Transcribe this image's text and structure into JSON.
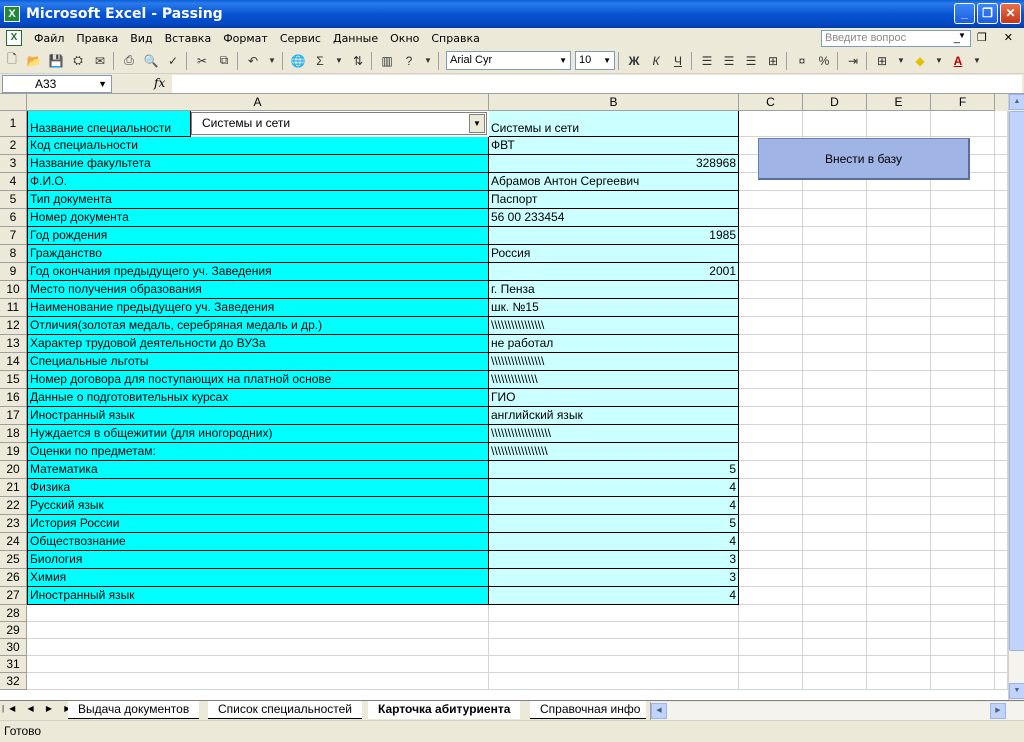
{
  "window": {
    "title": "Microsoft Excel - Passing",
    "app_icon": "X"
  },
  "menu": {
    "items": [
      "Файл",
      "Правка",
      "Вид",
      "Вставка",
      "Формат",
      "Сервис",
      "Данные",
      "Окно",
      "Справка"
    ],
    "help_placeholder": "Введите вопрос"
  },
  "toolbar": {
    "font_name": "Arial Cyr",
    "font_size": "10",
    "bold": "Ж",
    "italic": "К",
    "underline": "Ч",
    "percent": "%",
    "sum": "Σ"
  },
  "formula_bar": {
    "cell_ref": "A33",
    "fx": "fx",
    "content": ""
  },
  "columns": [
    "A",
    "B",
    "C",
    "D",
    "E",
    "F"
  ],
  "combo": {
    "value": "Системы и сети"
  },
  "macro_button": {
    "label": "Внести в базу"
  },
  "rows": [
    {
      "n": "1",
      "a": "Название специальности",
      "b": "Системы и сети",
      "num": false
    },
    {
      "n": "2",
      "a": "Код специальности",
      "b": "ФВТ",
      "num": false
    },
    {
      "n": "3",
      "a": "Название факультета",
      "b": "328968",
      "num": true
    },
    {
      "n": "4",
      "a": "Ф.И.О.",
      "b": "Абрамов Антон Сергеевич",
      "num": false
    },
    {
      "n": "5",
      "a": "Тип документа",
      "b": "Паспорт",
      "num": false
    },
    {
      "n": "6",
      "a": "Номер документа",
      "b": "56 00 233454",
      "num": false
    },
    {
      "n": "7",
      "a": "Год рождения",
      "b": "1985",
      "num": true
    },
    {
      "n": "8",
      "a": "Гражданство",
      "b": "Россия",
      "num": false
    },
    {
      "n": "9",
      "a": "Год окончания предыдущего уч. Заведения",
      "b": "2001",
      "num": true
    },
    {
      "n": "10",
      "a": "Место получения образования",
      "b": "г. Пенза",
      "num": false
    },
    {
      "n": "11",
      "a": "Наименование предыдущего уч. Заведения",
      "b": "шк. №15",
      "num": false
    },
    {
      "n": "12",
      "a": "Отличия(золотая медаль, серебряная медаль и др.)",
      "b": "\\\\\\\\\\\\\\\\\\\\\\\\\\\\\\\\",
      "num": false
    },
    {
      "n": "13",
      "a": "Характер трудовой деятельности до ВУЗа",
      "b": "не работал",
      "num": false
    },
    {
      "n": "14",
      "a": "Специальные льготы",
      "b": "\\\\\\\\\\\\\\\\\\\\\\\\\\\\\\\\",
      "num": false
    },
    {
      "n": "15",
      "a": "Номер договора для поступающих на платной основе",
      "b": "\\\\\\\\\\\\\\\\\\\\\\\\\\\\",
      "num": false
    },
    {
      "n": "16",
      "a": "Данные о подготовительных курсах",
      "b": "ГИО",
      "num": false
    },
    {
      "n": "17",
      "a": "Иностранный язык",
      "b": "английский язык",
      "num": false
    },
    {
      "n": "18",
      "a": "Нуждается в общежитии (для иногородних)",
      "b": "\\\\\\\\\\\\\\\\\\\\\\\\\\\\\\\\\\\\",
      "num": false
    },
    {
      "n": "19",
      "a": "Оценки по предметам:",
      "b": "\\\\\\\\\\\\\\\\\\\\\\\\\\\\\\\\\\",
      "num": false
    },
    {
      "n": "20",
      "a": "Математика",
      "b": "5",
      "num": true
    },
    {
      "n": "21",
      "a": "Физика",
      "b": "4",
      "num": true
    },
    {
      "n": "22",
      "a": "Русский язык",
      "b": "4",
      "num": true
    },
    {
      "n": "23",
      "a": "История России",
      "b": "5",
      "num": true
    },
    {
      "n": "24",
      "a": "Обществознание",
      "b": "4",
      "num": true
    },
    {
      "n": "25",
      "a": "Биология",
      "b": "3",
      "num": true
    },
    {
      "n": "26",
      "a": "Химия",
      "b": "3",
      "num": true
    },
    {
      "n": "27",
      "a": "Иностранный язык",
      "b": "4",
      "num": true
    }
  ],
  "empty_rows": [
    "28",
    "29",
    "30",
    "31",
    "32"
  ],
  "sheet_tabs": [
    {
      "label": "Выдача документов",
      "active": false
    },
    {
      "label": "Список специальностей",
      "active": false
    },
    {
      "label": "Карточка абитуриента",
      "active": true
    },
    {
      "label": "Справочная инфо",
      "active": false
    }
  ],
  "status": "Готово"
}
